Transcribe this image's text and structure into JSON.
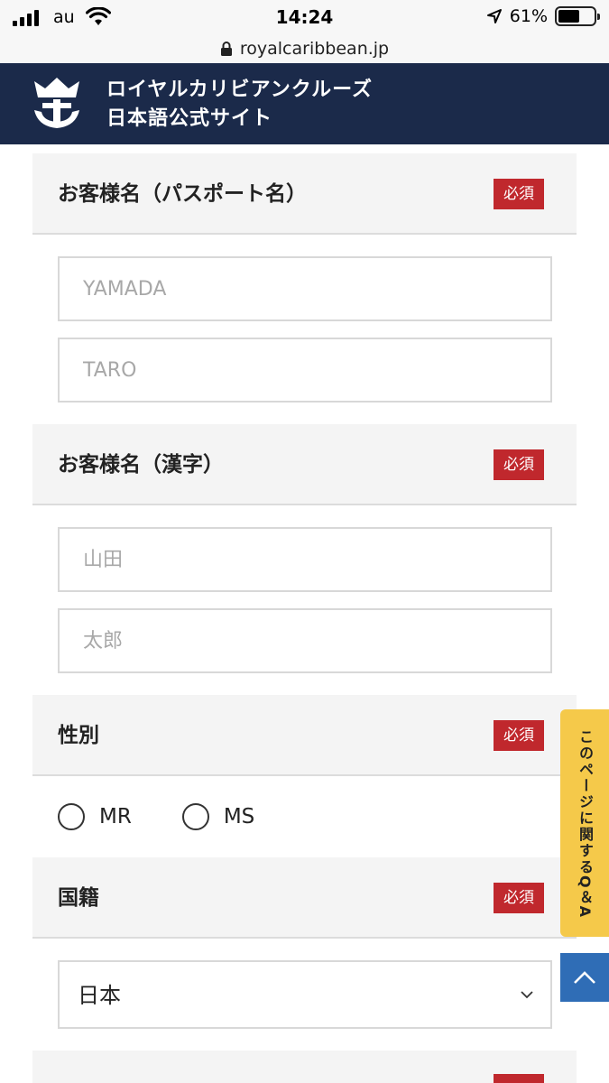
{
  "status_bar": {
    "carrier": "au",
    "time": "14:24",
    "battery_percent": "61%",
    "battery_level": 0.61
  },
  "browser": {
    "url": "royalcaribbean.jp"
  },
  "header": {
    "brand_line1": "ロイヤルカリビアンクルーズ",
    "brand_line2": "日本語公式サイト"
  },
  "form": {
    "required_label": "必須",
    "passport_name": {
      "title": "お客様名（パスポート名）",
      "last_placeholder": "YAMADA",
      "first_placeholder": "TARO"
    },
    "kanji_name": {
      "title": "お客様名（漢字）",
      "last_placeholder": "山田",
      "first_placeholder": "太郎"
    },
    "gender": {
      "title": "性別",
      "options": [
        "MR",
        "MS"
      ]
    },
    "nationality": {
      "title": "国籍",
      "selected": "日本"
    }
  },
  "floating": {
    "qa_label": "このページに関するQ＆A"
  },
  "colors": {
    "header_bg": "#1b2a4a",
    "required_badge": "#c0282d",
    "qa_tab": "#f5c94a",
    "top_button": "#2f6db6"
  }
}
